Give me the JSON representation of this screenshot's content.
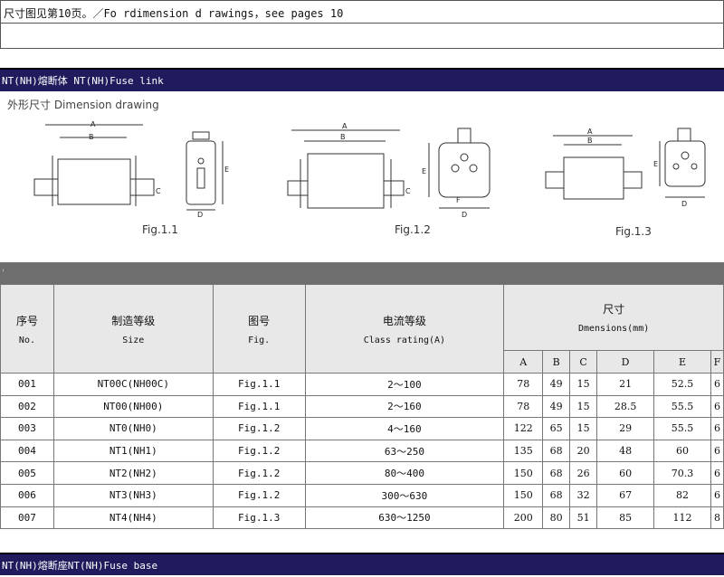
{
  "top_note": "尺寸图见第10页。／Fo rdimension d rawings，see pages 10",
  "section_fuse_link": "NT(NH)熔断体 NT(NH)Fuse link",
  "section_fuse_base": "NT(NH)熔断座NT(NH)Fuse base",
  "drawing_label": "外形尺寸 Dimension drawing",
  "figures": [
    "Fig.1.1",
    "Fig.1.2",
    "Fig.1.3"
  ],
  "drawing_letters": {
    "A": "A",
    "B": "B",
    "C": "C",
    "D": "D",
    "E": "E",
    "F": "F"
  },
  "strip_mark": "'",
  "table": {
    "headers": {
      "no_cn": "序号",
      "no_en": "No.",
      "size_cn": "制造等级",
      "size_en": "Size",
      "fig_cn": "图号",
      "fig_en": "Fig.",
      "rating_cn": "电流等级",
      "rating_en": "Class rating(A)",
      "dim_cn": "尺寸",
      "dim_en": "Dmensions(mm)",
      "dim_cols": [
        "A",
        "B",
        "C",
        "D",
        "E",
        "F"
      ]
    },
    "rows": [
      [
        "001",
        "NT00C(NH00C)",
        "Fig.1.1",
        "2～100",
        "78",
        "49",
        "15",
        "21",
        "52.5",
        "6"
      ],
      [
        "002",
        "NT00(NH00)",
        "Fig.1.1",
        "2～160",
        "78",
        "49",
        "15",
        "28.5",
        "55.5",
        "6"
      ],
      [
        "003",
        "NT0(NH0)",
        "Fig.1.2",
        "4～160",
        "122",
        "65",
        "15",
        "29",
        "55.5",
        "6"
      ],
      [
        "004",
        "NT1(NH1)",
        "Fig.1.2",
        "63～250",
        "135",
        "68",
        "20",
        "48",
        "60",
        "6"
      ],
      [
        "005",
        "NT2(NH2)",
        "Fig.1.2",
        "80～400",
        "150",
        "68",
        "26",
        "60",
        "70.3",
        "6"
      ],
      [
        "006",
        "NT3(NH3)",
        "Fig.1.2",
        "300～630",
        "150",
        "68",
        "32",
        "67",
        "82",
        "6"
      ],
      [
        "007",
        "NT4(NH4)",
        "Fig.1.3",
        "630～1250",
        "200",
        "80",
        "51",
        "85",
        "112",
        "8"
      ]
    ]
  }
}
